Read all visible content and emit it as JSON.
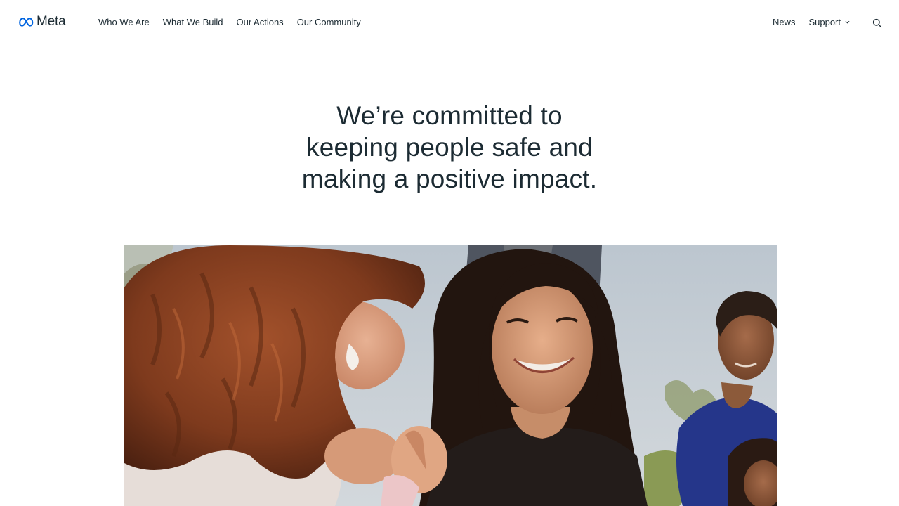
{
  "header": {
    "logo_text": "Meta",
    "nav": [
      {
        "label": "Who We Are"
      },
      {
        "label": "What We Build"
      },
      {
        "label": "Our Actions"
      },
      {
        "label": "Our Community"
      }
    ],
    "news_label": "News",
    "support_label": "Support",
    "search_icon": "search-icon"
  },
  "hero": {
    "title_line1": "We’re committed to",
    "title_line2": "keeping people safe and",
    "title_line3": "making a positive impact."
  },
  "colors": {
    "text": "#1c2b33",
    "brand_blue": "#0064e0",
    "divider": "#dadde1"
  }
}
